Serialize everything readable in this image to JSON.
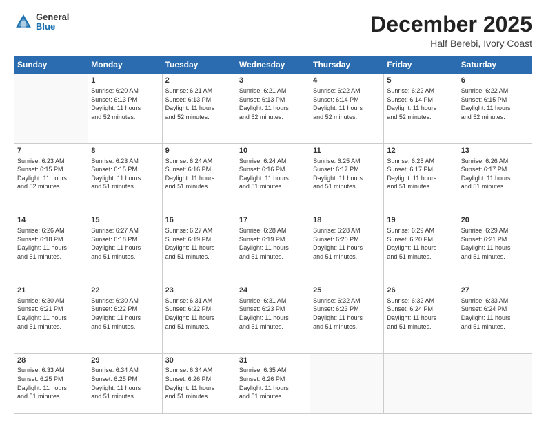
{
  "logo": {
    "general": "General",
    "blue": "Blue"
  },
  "title": "December 2025",
  "location": "Half Berebi, Ivory Coast",
  "days_header": [
    "Sunday",
    "Monday",
    "Tuesday",
    "Wednesday",
    "Thursday",
    "Friday",
    "Saturday"
  ],
  "weeks": [
    [
      {
        "day": "",
        "info": ""
      },
      {
        "day": "1",
        "info": "Sunrise: 6:20 AM\nSunset: 6:13 PM\nDaylight: 11 hours\nand 52 minutes."
      },
      {
        "day": "2",
        "info": "Sunrise: 6:21 AM\nSunset: 6:13 PM\nDaylight: 11 hours\nand 52 minutes."
      },
      {
        "day": "3",
        "info": "Sunrise: 6:21 AM\nSunset: 6:13 PM\nDaylight: 11 hours\nand 52 minutes."
      },
      {
        "day": "4",
        "info": "Sunrise: 6:22 AM\nSunset: 6:14 PM\nDaylight: 11 hours\nand 52 minutes."
      },
      {
        "day": "5",
        "info": "Sunrise: 6:22 AM\nSunset: 6:14 PM\nDaylight: 11 hours\nand 52 minutes."
      },
      {
        "day": "6",
        "info": "Sunrise: 6:22 AM\nSunset: 6:15 PM\nDaylight: 11 hours\nand 52 minutes."
      }
    ],
    [
      {
        "day": "7",
        "info": "Sunrise: 6:23 AM\nSunset: 6:15 PM\nDaylight: 11 hours\nand 52 minutes."
      },
      {
        "day": "8",
        "info": "Sunrise: 6:23 AM\nSunset: 6:15 PM\nDaylight: 11 hours\nand 51 minutes."
      },
      {
        "day": "9",
        "info": "Sunrise: 6:24 AM\nSunset: 6:16 PM\nDaylight: 11 hours\nand 51 minutes."
      },
      {
        "day": "10",
        "info": "Sunrise: 6:24 AM\nSunset: 6:16 PM\nDaylight: 11 hours\nand 51 minutes."
      },
      {
        "day": "11",
        "info": "Sunrise: 6:25 AM\nSunset: 6:17 PM\nDaylight: 11 hours\nand 51 minutes."
      },
      {
        "day": "12",
        "info": "Sunrise: 6:25 AM\nSunset: 6:17 PM\nDaylight: 11 hours\nand 51 minutes."
      },
      {
        "day": "13",
        "info": "Sunrise: 6:26 AM\nSunset: 6:17 PM\nDaylight: 11 hours\nand 51 minutes."
      }
    ],
    [
      {
        "day": "14",
        "info": "Sunrise: 6:26 AM\nSunset: 6:18 PM\nDaylight: 11 hours\nand 51 minutes."
      },
      {
        "day": "15",
        "info": "Sunrise: 6:27 AM\nSunset: 6:18 PM\nDaylight: 11 hours\nand 51 minutes."
      },
      {
        "day": "16",
        "info": "Sunrise: 6:27 AM\nSunset: 6:19 PM\nDaylight: 11 hours\nand 51 minutes."
      },
      {
        "day": "17",
        "info": "Sunrise: 6:28 AM\nSunset: 6:19 PM\nDaylight: 11 hours\nand 51 minutes."
      },
      {
        "day": "18",
        "info": "Sunrise: 6:28 AM\nSunset: 6:20 PM\nDaylight: 11 hours\nand 51 minutes."
      },
      {
        "day": "19",
        "info": "Sunrise: 6:29 AM\nSunset: 6:20 PM\nDaylight: 11 hours\nand 51 minutes."
      },
      {
        "day": "20",
        "info": "Sunrise: 6:29 AM\nSunset: 6:21 PM\nDaylight: 11 hours\nand 51 minutes."
      }
    ],
    [
      {
        "day": "21",
        "info": "Sunrise: 6:30 AM\nSunset: 6:21 PM\nDaylight: 11 hours\nand 51 minutes."
      },
      {
        "day": "22",
        "info": "Sunrise: 6:30 AM\nSunset: 6:22 PM\nDaylight: 11 hours\nand 51 minutes."
      },
      {
        "day": "23",
        "info": "Sunrise: 6:31 AM\nSunset: 6:22 PM\nDaylight: 11 hours\nand 51 minutes."
      },
      {
        "day": "24",
        "info": "Sunrise: 6:31 AM\nSunset: 6:23 PM\nDaylight: 11 hours\nand 51 minutes."
      },
      {
        "day": "25",
        "info": "Sunrise: 6:32 AM\nSunset: 6:23 PM\nDaylight: 11 hours\nand 51 minutes."
      },
      {
        "day": "26",
        "info": "Sunrise: 6:32 AM\nSunset: 6:24 PM\nDaylight: 11 hours\nand 51 minutes."
      },
      {
        "day": "27",
        "info": "Sunrise: 6:33 AM\nSunset: 6:24 PM\nDaylight: 11 hours\nand 51 minutes."
      }
    ],
    [
      {
        "day": "28",
        "info": "Sunrise: 6:33 AM\nSunset: 6:25 PM\nDaylight: 11 hours\nand 51 minutes."
      },
      {
        "day": "29",
        "info": "Sunrise: 6:34 AM\nSunset: 6:25 PM\nDaylight: 11 hours\nand 51 minutes."
      },
      {
        "day": "30",
        "info": "Sunrise: 6:34 AM\nSunset: 6:26 PM\nDaylight: 11 hours\nand 51 minutes."
      },
      {
        "day": "31",
        "info": "Sunrise: 6:35 AM\nSunset: 6:26 PM\nDaylight: 11 hours\nand 51 minutes."
      },
      {
        "day": "",
        "info": ""
      },
      {
        "day": "",
        "info": ""
      },
      {
        "day": "",
        "info": ""
      }
    ]
  ]
}
